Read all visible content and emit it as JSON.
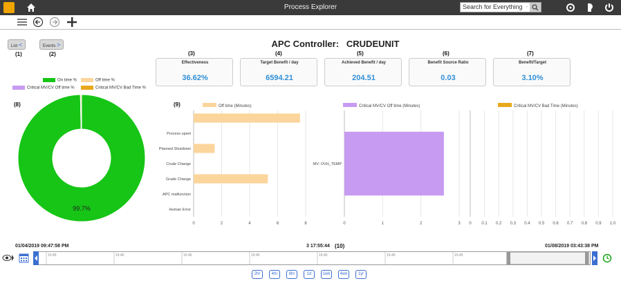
{
  "app": {
    "title": "Process Explorer"
  },
  "search": {
    "placeholder": "Search for Everything",
    "dropdown": "-"
  },
  "buttons": {
    "list": "List",
    "events": "Events",
    "list_arrow": "<",
    "events_arrow": ">"
  },
  "labels": {
    "n1": "(1)",
    "n2": "(2)",
    "n3": "(3)",
    "n4": "(4)",
    "n5": "(5)",
    "n6": "(6)",
    "n7": "(7)",
    "n8": "(8)",
    "n9": "(9)",
    "n10": "(10)"
  },
  "controller": {
    "prefix": "APC Controller:",
    "name": "CRUDEUNIT"
  },
  "kpis": [
    {
      "label": "Effectiveness",
      "value": "36.62%"
    },
    {
      "label": "Target Benefit / day",
      "value": "6594.21"
    },
    {
      "label": "Achieved Benefit / day",
      "value": "204.51"
    },
    {
      "label": "Benefit Source Ratio",
      "value": "0.03"
    },
    {
      "label": "Benefit/Target",
      "value": "3.10%"
    }
  ],
  "donut_legend": {
    "on": "On time %",
    "off": "Off time %",
    "crit_off": "Critical MV/CV Off time %",
    "crit_bad": "Critical MV/CV Bad Time %"
  },
  "colors": {
    "on": "#16c516",
    "off": "#fcd59c",
    "crit_off": "#c79bf2",
    "crit_bad": "#e7a81c",
    "accent": "#2f8fd8"
  },
  "timeline": {
    "start": "01/04/2019 09:47:58 PM",
    "center": "3 17:55:44",
    "end": "01/08/2019 03:43:38 PM",
    "ticks": [
      "15:45",
      "15:45",
      "15:45",
      "15:45",
      "15:45",
      "15:45",
      "15:45",
      "15:45"
    ],
    "ranges": [
      "2hr",
      "4hr",
      "8hr",
      "1d",
      "1wk",
      "4wk",
      "1yr"
    ]
  },
  "chart_data": [
    {
      "type": "pie",
      "labels": [
        "On time %",
        "Off time %",
        "Critical MV/CV Off time %",
        "Critical MV/CV Bad Time %"
      ],
      "values": [
        99.7,
        0.3,
        0,
        0
      ],
      "data_label": "99.7%"
    },
    {
      "type": "bar",
      "orientation": "horizontal",
      "series": [
        {
          "name": "Off time (Minutes)",
          "values": [
            7.6,
            0,
            1.5,
            0,
            5.3,
            0,
            0
          ]
        }
      ],
      "categories": [
        "",
        "Process upset",
        "Planned Shutdown",
        "Crude Change",
        "Grade Change",
        "APC malfunction",
        "Human Error"
      ],
      "xlim": [
        0,
        8
      ],
      "xticks": [
        "0",
        "2",
        "4",
        "6",
        "8"
      ]
    },
    {
      "type": "bar",
      "orientation": "horizontal",
      "series": [
        {
          "name": "Critical MV/CV Off time (Minutes)",
          "values": [
            2.6
          ]
        }
      ],
      "categories": [
        "MV: OVH_TEMP"
      ],
      "xlim": [
        0,
        3
      ],
      "xticks": [
        "0",
        "1",
        "2",
        "3"
      ]
    },
    {
      "type": "bar",
      "orientation": "horizontal",
      "series": [
        {
          "name": "Critical MV/CV Bad Time (Minutes)",
          "values": []
        }
      ],
      "categories": [],
      "xlim": [
        0,
        1
      ],
      "xticks": [
        "0",
        "0.1",
        "0.2",
        "0.3",
        "0.4",
        "0.5",
        "0.6",
        "0.7",
        "0.8",
        "0.9",
        "1.0"
      ]
    }
  ]
}
